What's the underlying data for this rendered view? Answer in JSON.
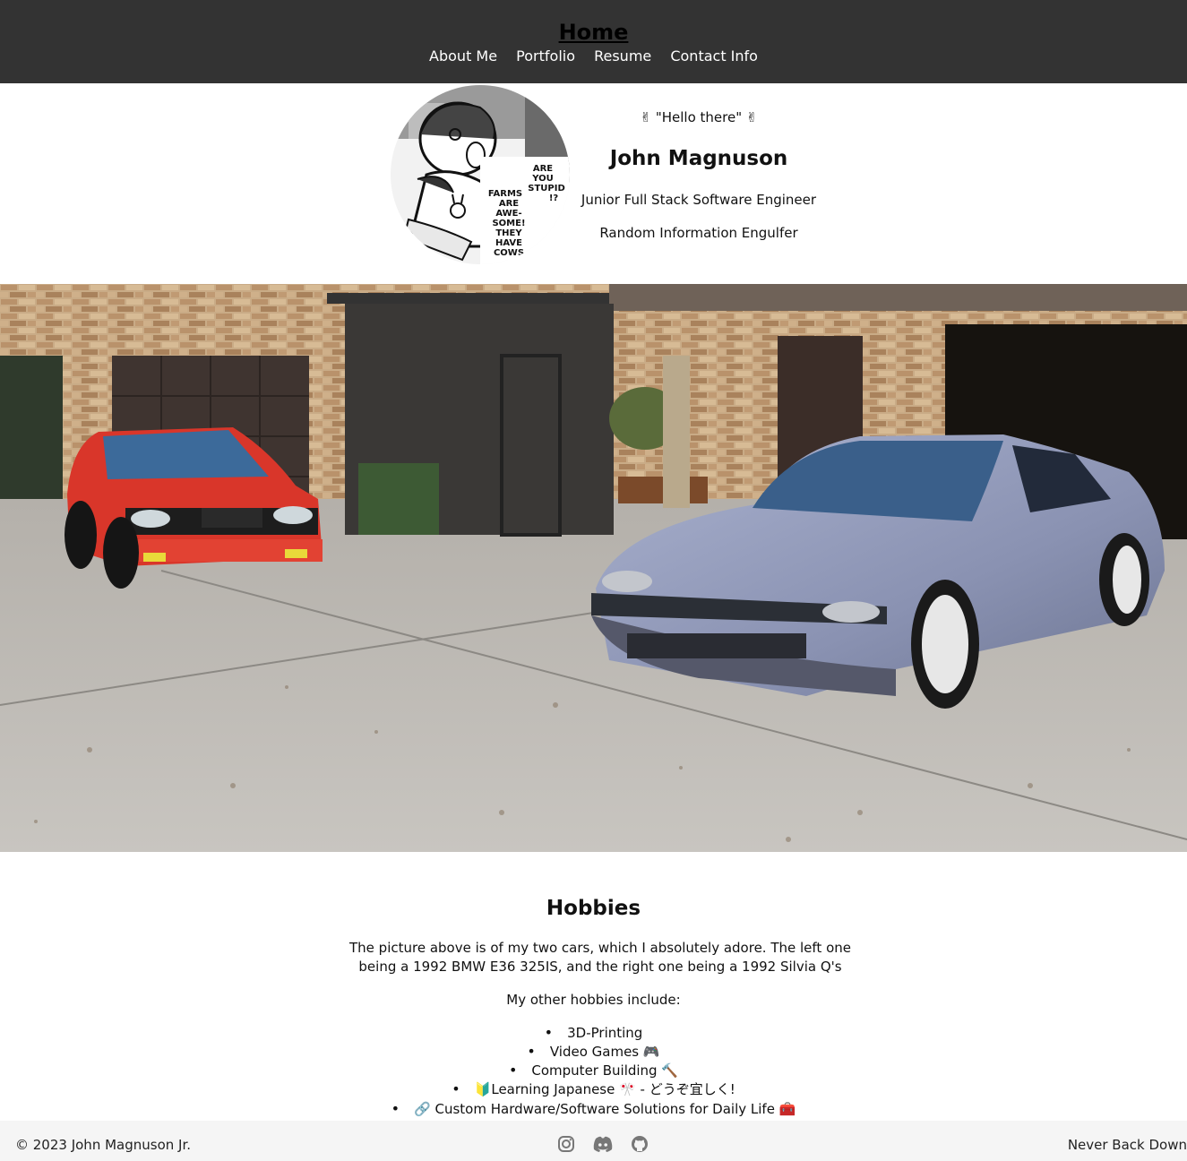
{
  "nav": {
    "home": "Home",
    "links": [
      "About Me",
      "Portfolio",
      "Resume",
      "Contact Info"
    ]
  },
  "profile": {
    "greeting": "✌ \"Hello there\" ✌",
    "name": "John Magnuson",
    "role": "Junior Full Stack Software Engineer",
    "tagline": "Random Information Engulfer",
    "avatar_text": [
      "ARE YOU STUPID !?",
      "FARMS ARE AWE-SOME! THEY HAVE COWS"
    ]
  },
  "hobbies": {
    "title": "Hobbies",
    "description": "The picture above is of my two cars, which I absolutely adore. The left one being a 1992 BMW E36 325IS, and the right one being a 1992 Silvia Q's",
    "intro": "My other hobbies include:",
    "items": [
      "3D-Printing",
      "Video Games 🎮",
      "Computer Building 🔨",
      "🔰Learning Japanese 🎌 - どうぞ宜しく!",
      "🔗 Custom Hardware/Software Solutions for Daily Life 🧰"
    ]
  },
  "footer": {
    "copyright": "© 2023 John Magnuson Jr.",
    "motto": "Never Back Down",
    "social_icons": [
      "instagram-icon",
      "discord-icon",
      "github-icon"
    ]
  }
}
